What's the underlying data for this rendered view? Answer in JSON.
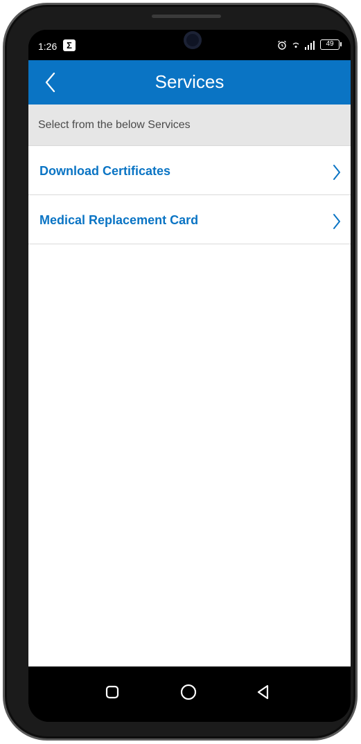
{
  "status_bar": {
    "time": "1:26",
    "notification_icon": "sigma-icon",
    "battery": "49",
    "icons": [
      "alarm-icon",
      "wifi-icon",
      "signal-icon",
      "battery-icon"
    ]
  },
  "app_bar": {
    "title": "Services",
    "back_icon": "chevron-left-icon",
    "color": "#0a74c4"
  },
  "subheader": {
    "text": "Select from the below Services"
  },
  "services": [
    {
      "label": "Download Certificates",
      "icon": "chevron-right-icon"
    },
    {
      "label": "Medical Replacement Card",
      "icon": "chevron-right-icon"
    }
  ],
  "nav_bar": {
    "buttons": [
      "recents-square-icon",
      "home-circle-icon",
      "back-triangle-icon"
    ]
  },
  "colors": {
    "accent": "#0a74c4",
    "subheader_bg": "#e6e6e6",
    "divider": "#d9d9d9"
  }
}
